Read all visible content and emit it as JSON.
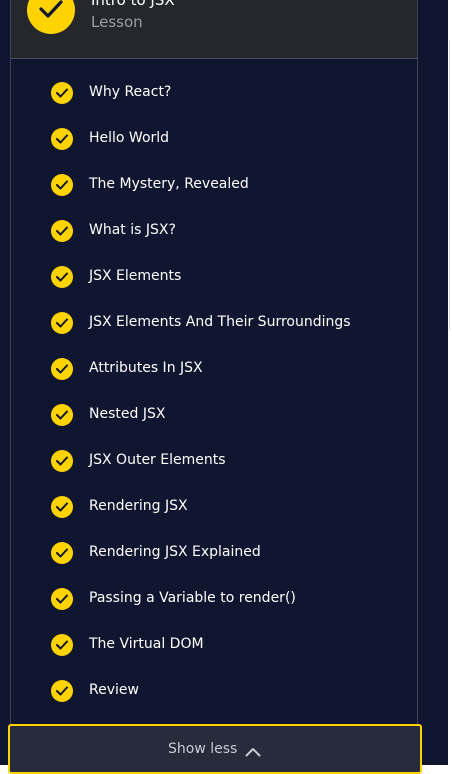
{
  "header": {
    "title": "Intro to JSX",
    "subtitle": "Lesson"
  },
  "items": [
    {
      "label": "Why React?"
    },
    {
      "label": "Hello World"
    },
    {
      "label": "The Mystery, Revealed"
    },
    {
      "label": "What is JSX?"
    },
    {
      "label": "JSX Elements"
    },
    {
      "label": "JSX Elements And Their Surroundings"
    },
    {
      "label": "Attributes In JSX"
    },
    {
      "label": "Nested JSX"
    },
    {
      "label": "JSX Outer Elements"
    },
    {
      "label": "Rendering JSX"
    },
    {
      "label": "Rendering JSX Explained"
    },
    {
      "label": "Passing a Variable to render()"
    },
    {
      "label": "The Virtual DOM"
    },
    {
      "label": "Review"
    }
  ],
  "footer": {
    "show_less_label": "Show less"
  },
  "colors": {
    "background": "#10162f",
    "accent": "#ffd300",
    "header_bg": "#24272b"
  }
}
